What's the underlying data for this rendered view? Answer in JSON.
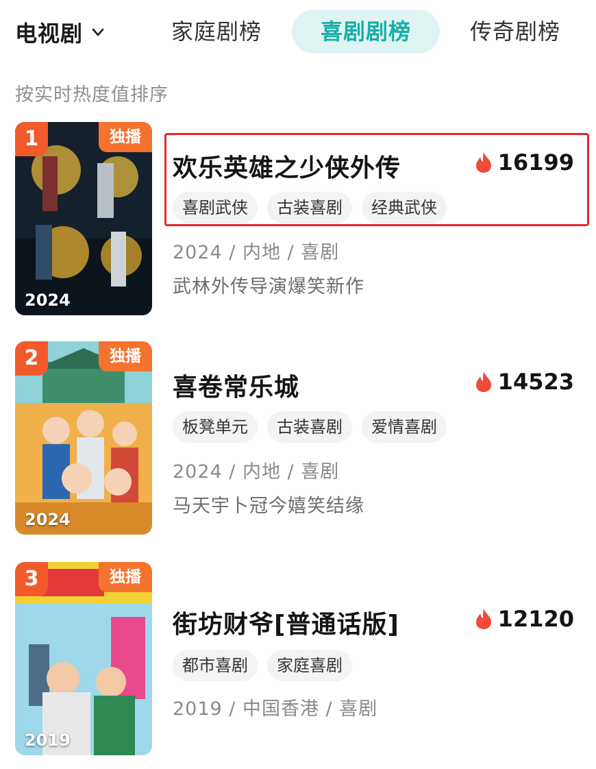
{
  "nav": {
    "category": "电视剧",
    "tabs": [
      {
        "label": "家庭剧榜",
        "active": false
      },
      {
        "label": "喜剧剧榜",
        "active": true
      },
      {
        "label": "传奇剧榜",
        "active": false
      }
    ],
    "active_color": "#18aea8"
  },
  "sort_hint": "按实时热度值排序",
  "items": [
    {
      "rank": "1",
      "badge": "独播",
      "poster_year": "2024",
      "title": "欢乐英雄之少侠外传",
      "heat": "16199",
      "tags": [
        "喜剧武侠",
        "古装喜剧",
        "经典武侠"
      ],
      "meta": "2024 / 内地 / 喜剧",
      "desc": "武林外传导演爆笑新作",
      "highlighted": true
    },
    {
      "rank": "2",
      "badge": "独播",
      "poster_year": "2024",
      "title": "喜卷常乐城",
      "heat": "14523",
      "tags": [
        "板凳单元",
        "古装喜剧",
        "爱情喜剧"
      ],
      "meta": "2024 / 内地 / 喜剧",
      "desc": "马天宇卜冠今嬉笑结缘"
    },
    {
      "rank": "3",
      "badge": "独播",
      "poster_year": "2019",
      "title": "街坊财爷[普通话版]",
      "heat": "12120",
      "tags": [
        "都市喜剧",
        "家庭喜剧"
      ],
      "meta": "2019 / 中国香港 / 喜剧"
    }
  ],
  "icons": {
    "category_dropdown": "chevron-down-icon",
    "heat": "flame-icon"
  },
  "colors": {
    "rank_badge": "#f25a2a",
    "exclusive_badge": "#f5722f",
    "flame": "#f04a3c",
    "highlight_border": "#e8262f"
  }
}
